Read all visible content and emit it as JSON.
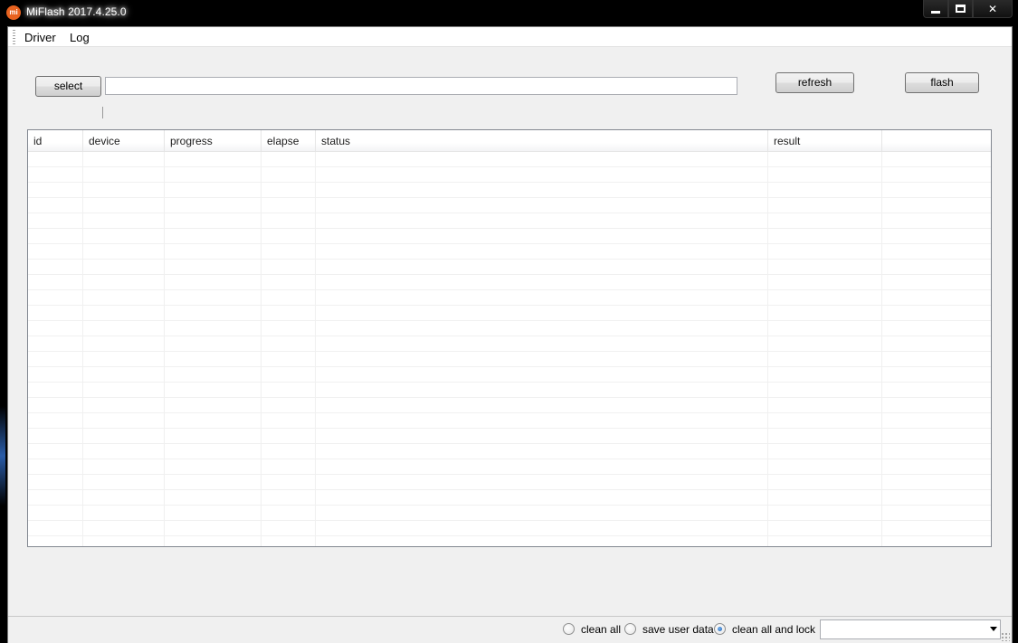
{
  "window": {
    "title": "MiFlash 2017.4.25.0",
    "app_icon_text": "mi",
    "controls": {
      "minimize": "minimize-icon",
      "maximize": "maximize-icon",
      "close": "close-icon",
      "close_glyph": "✕"
    }
  },
  "menu": {
    "items": [
      {
        "label": "Driver"
      },
      {
        "label": "Log"
      }
    ]
  },
  "toolbar": {
    "select_label": "select",
    "path_value": "",
    "refresh_label": "refresh",
    "flash_label": "flash"
  },
  "table": {
    "columns": [
      {
        "label": "id"
      },
      {
        "label": "device"
      },
      {
        "label": "progress"
      },
      {
        "label": "elapse"
      },
      {
        "label": "status"
      },
      {
        "label": "result"
      },
      {
        "label": ""
      }
    ],
    "rows": []
  },
  "footer": {
    "options": [
      {
        "label": "clean all",
        "checked": false
      },
      {
        "label": "save user data",
        "checked": false
      },
      {
        "label": "clean all and lock",
        "checked": true
      }
    ],
    "combo_value": ""
  },
  "colors": {
    "accent_radio": "#1c5fb0",
    "app_icon": "#e8621f"
  }
}
